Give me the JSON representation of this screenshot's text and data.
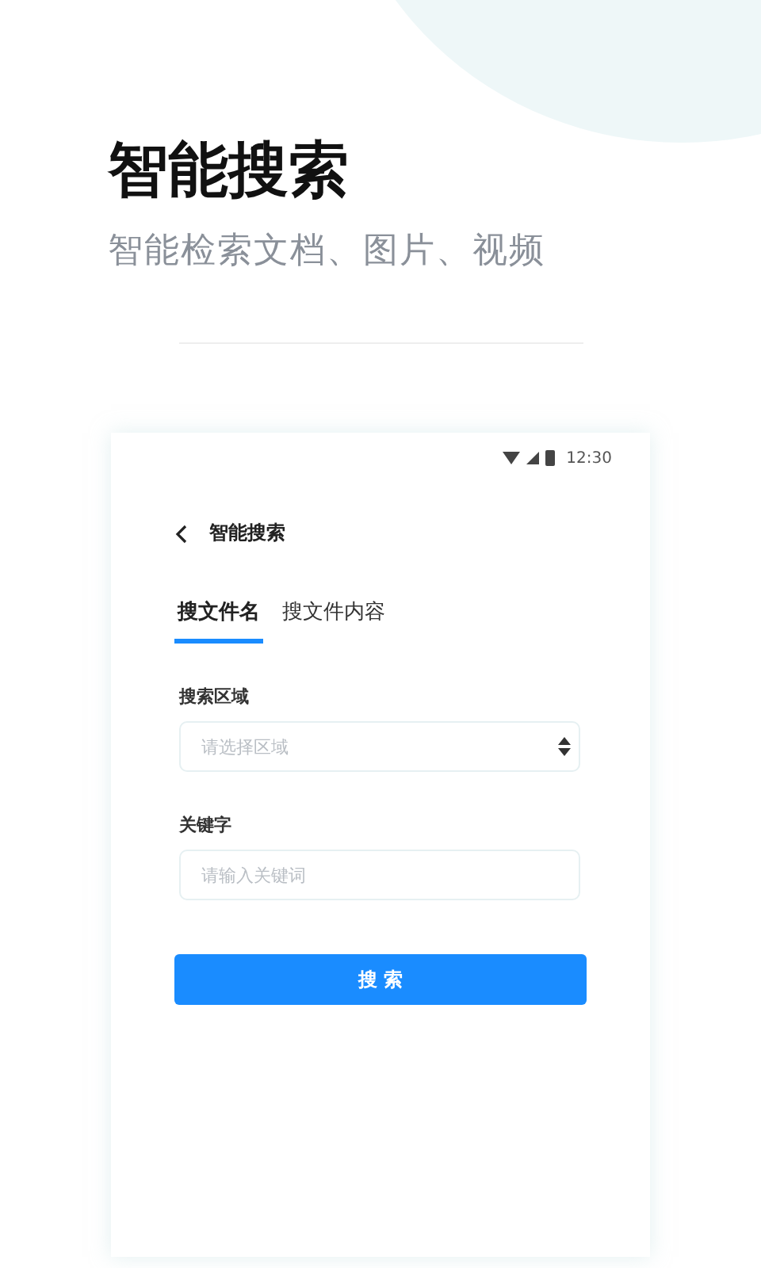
{
  "headline": "智能搜索",
  "subtitle": "智能检索文档、图片、视频",
  "phone": {
    "status_bar": {
      "time": "12:30"
    },
    "nav": {
      "title": "智能搜索"
    },
    "tabs": [
      {
        "label": "搜文件名",
        "selected": true
      },
      {
        "label": "搜文件内容",
        "selected": false
      }
    ],
    "fields": [
      {
        "kind": "select",
        "label": "搜索区域",
        "placeholder": "请选择区域"
      },
      {
        "kind": "input",
        "label": "关键字",
        "placeholder": "请输入关键词"
      }
    ],
    "button": "搜 索"
  }
}
